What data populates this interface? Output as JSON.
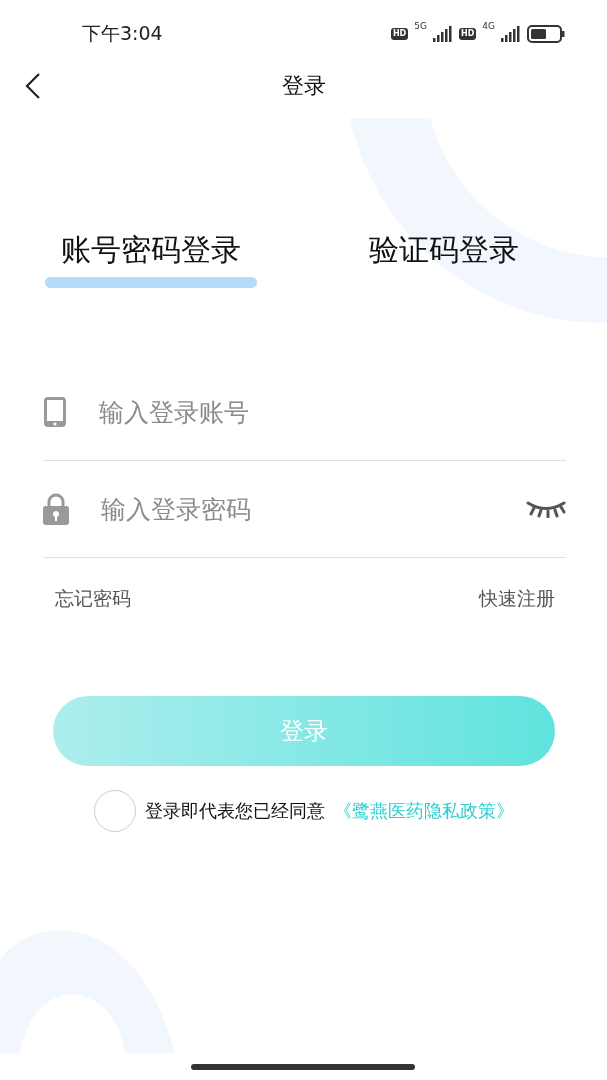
{
  "status_bar": {
    "time": "下午3:04",
    "badges": [
      "HD",
      "HD"
    ],
    "networks": [
      "5G",
      "4G"
    ]
  },
  "header": {
    "title": "登录"
  },
  "tabs": [
    {
      "label": "账号密码登录",
      "selected": true
    },
    {
      "label": "验证码登录",
      "selected": false
    }
  ],
  "fields": [
    {
      "kind": "account",
      "placeholder": "输入登录账号"
    },
    {
      "kind": "password",
      "placeholder": "输入登录密码"
    }
  ],
  "links": {
    "forgot": "忘记密码",
    "register": "快速注册"
  },
  "login_button": "登录",
  "agreement": {
    "checked": false,
    "text": "登录即代表您已经同意",
    "link": "《鹭燕医药隐私政策》"
  }
}
